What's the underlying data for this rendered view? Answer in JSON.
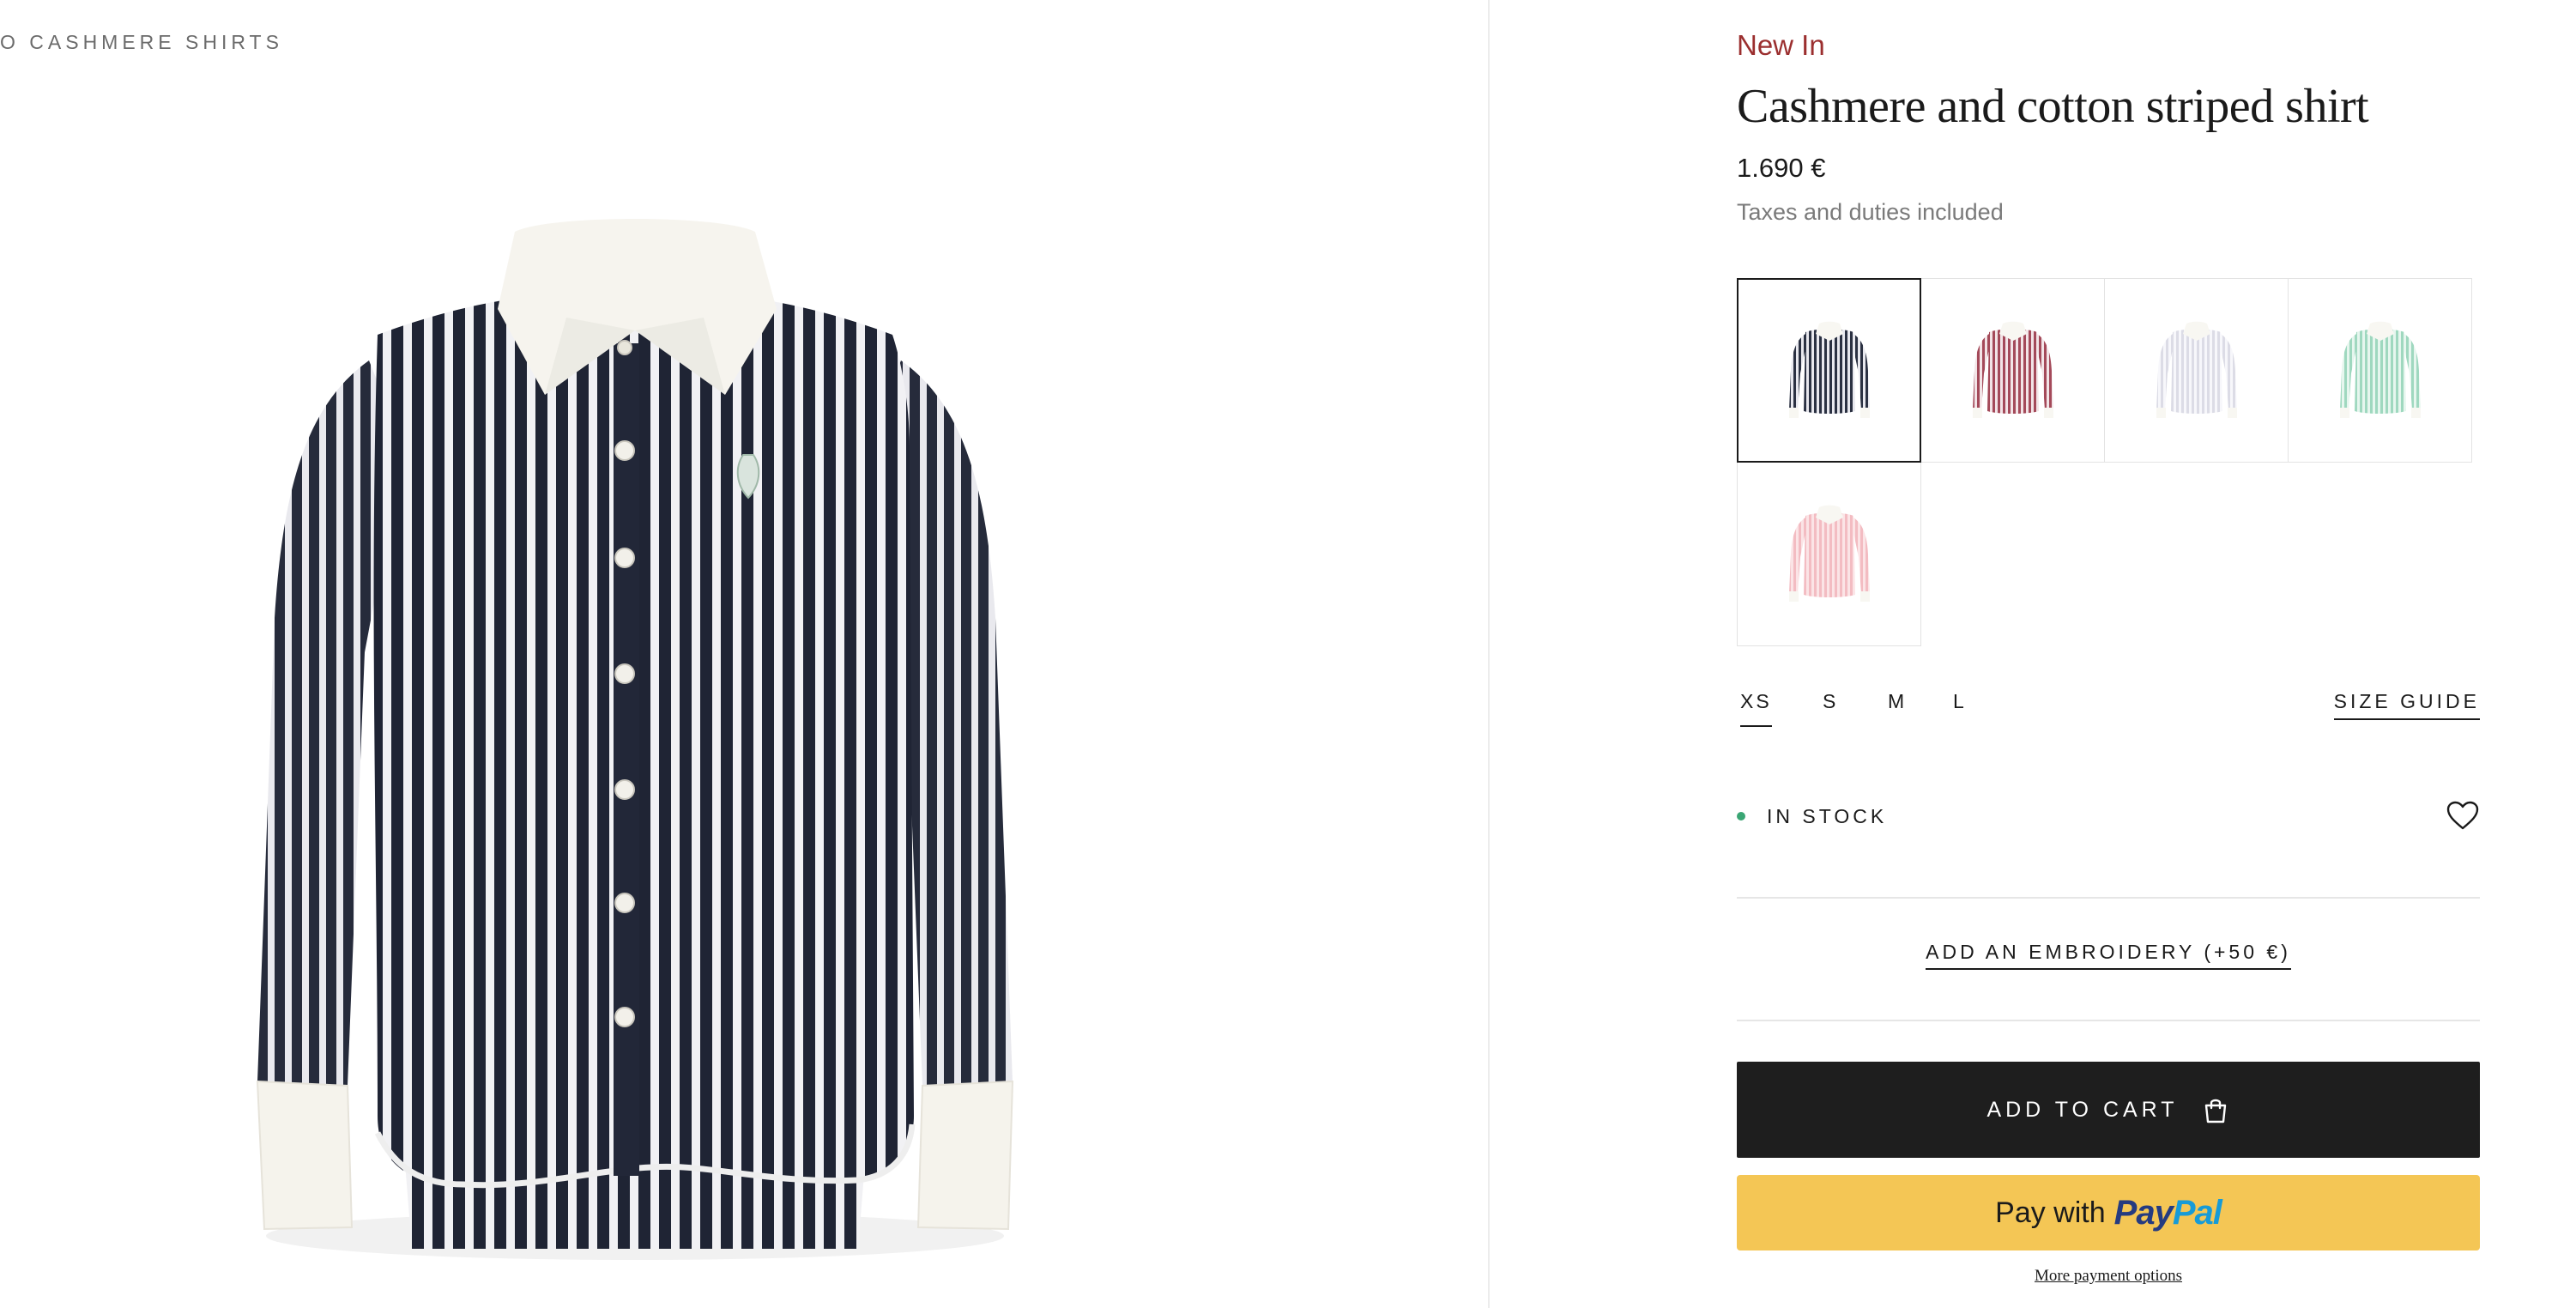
{
  "breadcrumb": {
    "text": "O CASHMERE SHIRTS"
  },
  "product": {
    "badge": "New In",
    "title": "Cashmere and cotton striped shirt",
    "price": "1.690 €",
    "tax_note": "Taxes and duties included"
  },
  "colors": {
    "badge": "#9b2f2f",
    "stock_dot": "#3aa674",
    "cart_button": "#1e1e1e",
    "paypal_button": "#f4c655"
  },
  "swatches": [
    {
      "name": "navy",
      "body_color": "#2b3142",
      "stripe_color": "#e8e8ee",
      "selected": true
    },
    {
      "name": "burgundy",
      "body_color": "#a44a5a",
      "stripe_color": "#f2e4e7",
      "selected": false
    },
    {
      "name": "white",
      "body_color": "#dcdce6",
      "stripe_color": "#f7f7fb",
      "selected": false
    },
    {
      "name": "mint",
      "body_color": "#9fd8bf",
      "stripe_color": "#e6f6ee",
      "selected": false
    },
    {
      "name": "pink",
      "body_color": "#f3bcc2",
      "stripe_color": "#fbe4e6",
      "selected": false
    }
  ],
  "sizes": {
    "options": [
      "XS",
      "S",
      "M",
      "L"
    ],
    "selected": "XS",
    "guide_label": "SIZE GUIDE"
  },
  "stock": {
    "label": "IN STOCK",
    "icon": "heart-icon"
  },
  "embroidery": {
    "label": "ADD AN EMBROIDERY (+50 €)"
  },
  "cart": {
    "label": "ADD TO CART",
    "icon": "shopping-bag-icon"
  },
  "paypal": {
    "pay_with": "Pay with",
    "brand_part1": "Pay",
    "brand_part2": "Pal"
  },
  "more_payments": {
    "label": "More payment options"
  }
}
